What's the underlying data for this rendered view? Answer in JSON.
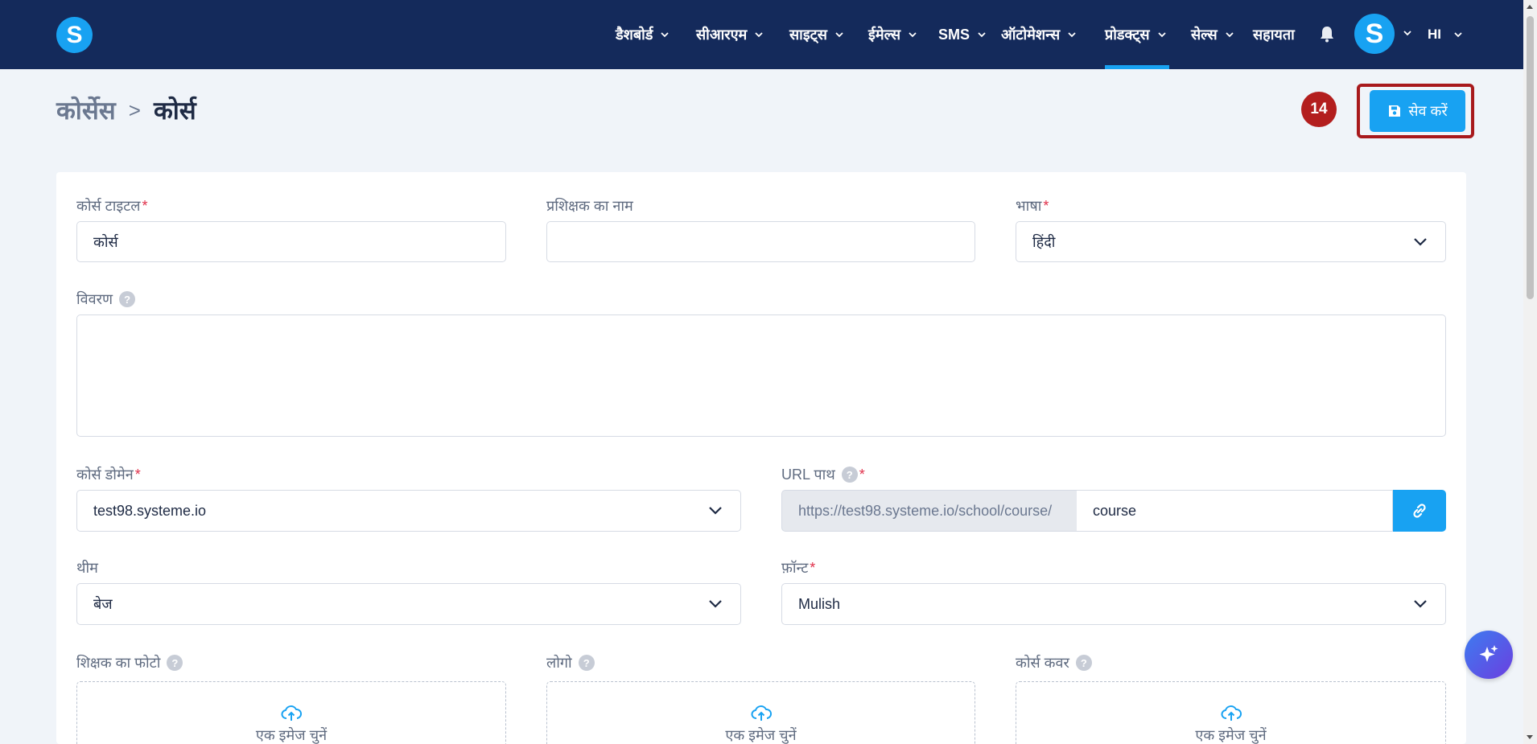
{
  "nav": {
    "items": [
      {
        "label": "डैशबोर्ड"
      },
      {
        "label": "सीआरएम"
      },
      {
        "label": "साइट्स"
      },
      {
        "label": "ईमेल्स"
      },
      {
        "label": "SMS"
      },
      {
        "label": "ऑटोमेशन्स"
      },
      {
        "label": "प्रोडक्ट्स",
        "active": true
      },
      {
        "label": "सेल्स"
      },
      {
        "label": "सहायता"
      }
    ],
    "logo_letter": "S",
    "avatar_letter": "S",
    "language": "HI"
  },
  "header": {
    "breadcrumb_parent": "कोर्सेस",
    "breadcrumb_separator": ">",
    "breadcrumb_current": "कोर्स",
    "step_badge": "14",
    "save_label": "सेव करें"
  },
  "form": {
    "course_title": {
      "label": "कोर्स टाइटल",
      "value": "कोर्स"
    },
    "instructor_name": {
      "label": "प्रशिक्षक का नाम",
      "value": ""
    },
    "language": {
      "label": "भाषा",
      "value": "हिंदी"
    },
    "description": {
      "label": "विवरण",
      "value": ""
    },
    "course_domain": {
      "label": "कोर्स डोमेन",
      "value": "test98.systeme.io"
    },
    "url_path": {
      "label": "URL पाथ",
      "prefix": "https://test98.systeme.io/school/course/",
      "value": "course"
    },
    "theme": {
      "label": "थीम",
      "value": "बेज"
    },
    "font": {
      "label": "फ़ॉन्ट",
      "value": "Mulish"
    },
    "instructor_photo": {
      "label": "शिक्षक का फोटो",
      "upload_text": "एक इमेज चुनें"
    },
    "logo": {
      "label": "लोगो",
      "upload_text": "एक इमेज चुनें"
    },
    "course_cover": {
      "label": "कोर्स कवर",
      "upload_text": "एक इमेज चुनें"
    },
    "required_mark": "*",
    "help_mark": "?"
  },
  "colors": {
    "nav_bg": "#142a5b",
    "accent": "#18a2f2",
    "highlight": "#a8191c",
    "badge": "#b31e1e",
    "required": "#e0304a"
  }
}
